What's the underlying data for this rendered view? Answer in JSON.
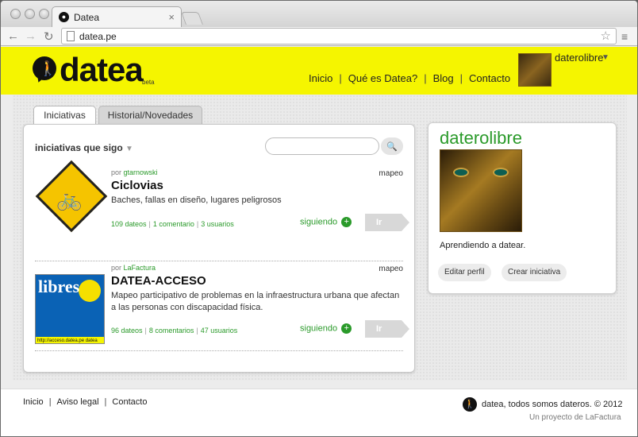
{
  "browser": {
    "tab_title": "Datea",
    "tab_close": "×",
    "url": "datea.pe",
    "back": "←",
    "forward": "→",
    "reload": "↻",
    "star": "☆",
    "menu": "≡"
  },
  "header": {
    "logo_text": "datea",
    "logo_beta": "beta",
    "nav": [
      "Inicio",
      "Qué es Datea?",
      "Blog",
      "Contacto"
    ],
    "nav_separator": "|",
    "username": "daterolibre",
    "user_caret": "▼"
  },
  "tabs": [
    "Iniciativas",
    "Historial/Novedades"
  ],
  "filter": {
    "label": "iniciativas que sigo",
    "caret": "▼",
    "search_placeholder": "",
    "search_icon_glyph": "🔍"
  },
  "items": [
    {
      "author_prefix": "por ",
      "author": "gtarnowski",
      "type": "mapeo",
      "title": "Ciclovias",
      "description": "Baches, fallas en diseño, lugares peligrosos",
      "stats": [
        "109 dateos",
        "1 comentario",
        "3 usuarios"
      ],
      "follow_label": "siguiendo",
      "follow_glyph": "+",
      "go_label": "Ir",
      "thumb_glyph": "🚲"
    },
    {
      "author_prefix": "por ",
      "author": "LaFactura",
      "type": "mapeo",
      "title": "DATEA-ACCESO",
      "description": "Mapeo participativo de problemas en la infraestructura urbana que afectan a las personas con discapacidad física.",
      "stats": [
        "96 dateos",
        "8 comentarios",
        "47 usuarios"
      ],
      "follow_label": "siguiendo",
      "follow_glyph": "+",
      "go_label": "Ir",
      "thumb_word": "libres",
      "thumb_strip": "http://acceso.datea.pe  datea"
    }
  ],
  "profile": {
    "name": "daterolibre",
    "bio": "Aprendiendo a datear.",
    "edit_label": "Editar perfil",
    "create_label": "Crear iniciativa"
  },
  "footer": {
    "links": [
      "Inicio",
      "Aviso legal",
      "Contacto"
    ],
    "separator": "|",
    "copyright": "datea, todos somos dateros. © 2012",
    "credit": "Un proyecto de LaFactura"
  },
  "colors": {
    "brand_yellow": "#f5f500",
    "link_green": "#2a9a2a"
  }
}
